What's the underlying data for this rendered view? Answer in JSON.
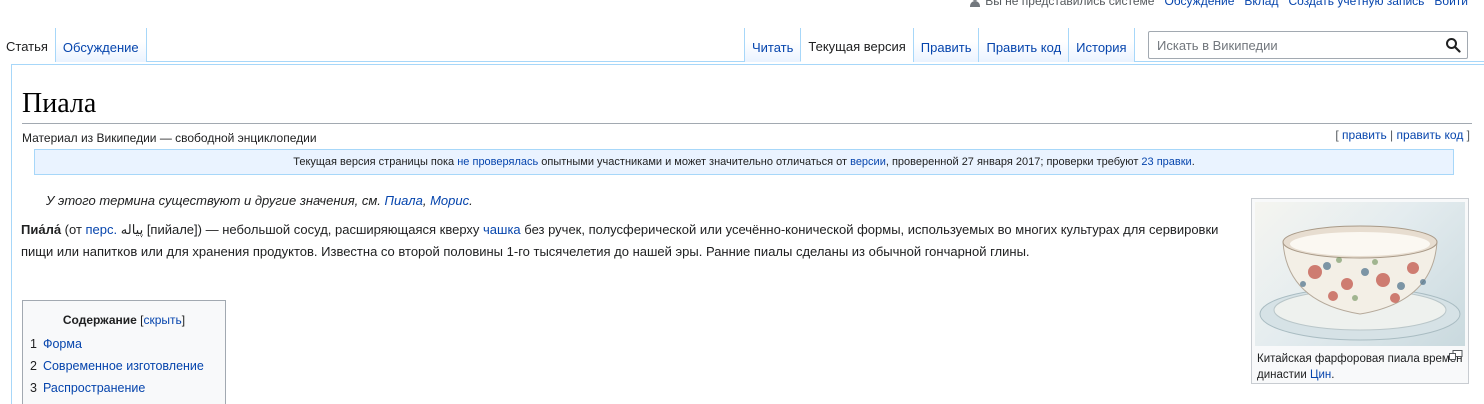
{
  "personal": {
    "anon": "Вы не представились системе",
    "links": [
      "Обсуждение",
      "Вклад",
      "Создать учётную запись",
      "Войти"
    ]
  },
  "tabs": {
    "left": [
      {
        "label": "Статья",
        "selected": true
      },
      {
        "label": "Обсуждение",
        "selected": false
      }
    ],
    "right": [
      {
        "label": "Читать",
        "selected": false
      },
      {
        "label": "Текущая версия",
        "selected": true
      },
      {
        "label": "Править",
        "selected": false
      },
      {
        "label": "Править код",
        "selected": false
      },
      {
        "label": "История",
        "selected": false
      }
    ]
  },
  "search": {
    "placeholder": "Искать в Википедии"
  },
  "article": {
    "title": "Пиала",
    "site_sub": "Материал из Википедии — свободной энциклопедии",
    "edit": {
      "open": "[ ",
      "edit": "править",
      "sep": " | ",
      "edit_code": "править код",
      "close": " ]"
    },
    "flagged": {
      "t1": "Текущая версия страницы пока ",
      "l1": "не проверялась",
      "t2": " опытными участниками и может значительно отличаться от ",
      "l2": "версии",
      "t3": ", проверенной 27 января 2017; проверки требуют ",
      "l3": "23 правки",
      "t4": "."
    },
    "hatnote": {
      "text": "У этого термина существуют и другие значения, см. ",
      "l1": "Пиала",
      "sep": ", ",
      "l2": "Морис",
      "end": "."
    },
    "lead": {
      "bold": "Пиа́ла́",
      "t1": " (от ",
      "l1": "перс.",
      "t2": " پیاله [пийале]) — небольшой сосуд, расширяющаяся кверху ",
      "l2": "чашка",
      "t3": " без ручек, полусферической или усечённо-конической формы, используемых во многих культурах для сервировки пищи или напитков или для хранения продуктов. Известна со второй половины 1-го тысячелетия до нашей эры. Ранние пиалы сделаны из обычной гончарной глины."
    },
    "toc": {
      "title": "Содержание",
      "toggle_open": " [",
      "toggle": "скрыть",
      "toggle_close": "]",
      "items": [
        {
          "num": "1",
          "label": "Форма"
        },
        {
          "num": "2",
          "label": "Современное изготовление"
        },
        {
          "num": "3",
          "label": "Распространение"
        }
      ]
    },
    "thumb": {
      "caption": "Китайская фарфоровая пиала времен династии ",
      "link": "Цин",
      "end": "."
    }
  },
  "colors": {
    "link": "#0645ad",
    "tab_border": "#a7d7f9",
    "flagged_bg": "#eaf3ff"
  }
}
